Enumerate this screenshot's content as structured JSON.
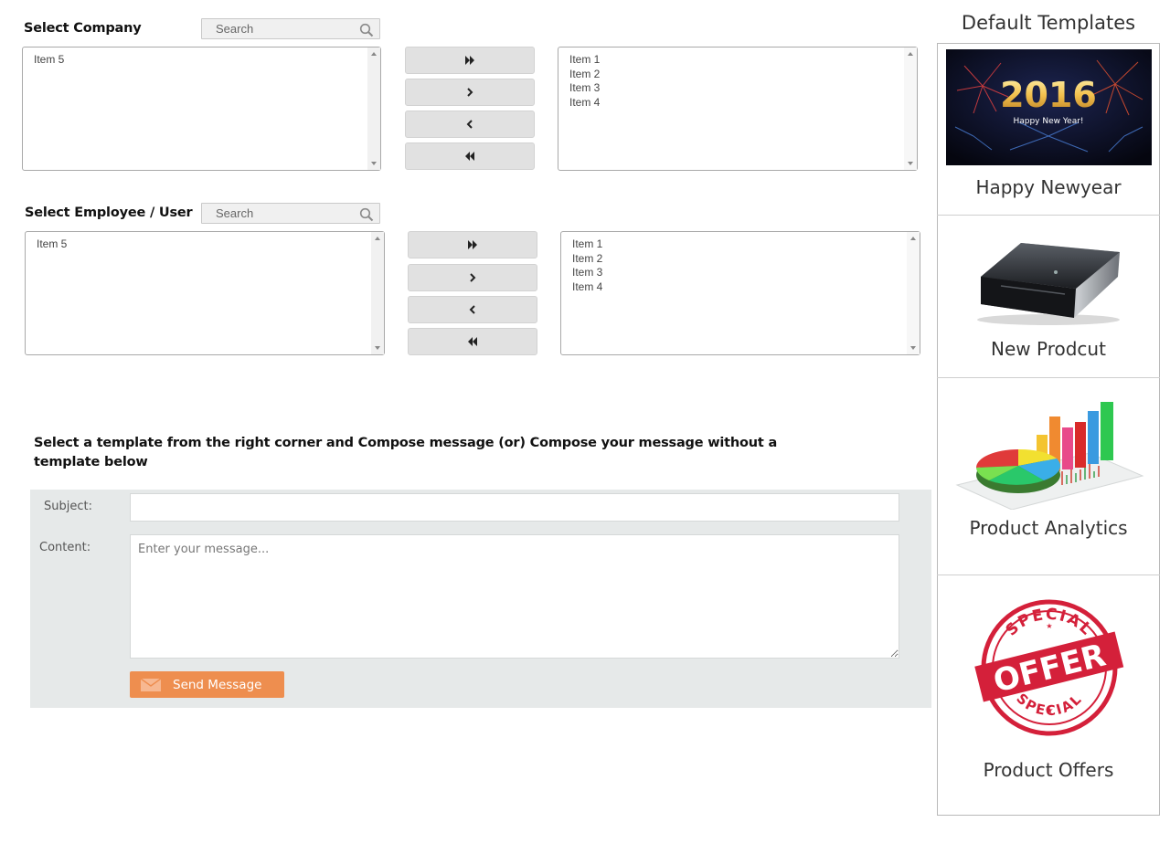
{
  "company": {
    "label": "Select Company",
    "search_placeholder": "Search",
    "available": [
      "Item 5"
    ],
    "selected": [
      "Item 1",
      "Item 2",
      "Item 3",
      "Item 4"
    ]
  },
  "employee": {
    "label": "Select Employee / User",
    "search_placeholder": "Search",
    "available": [
      "Item 5"
    ],
    "selected": [
      "Item 1",
      "Item 2",
      "Item 3",
      "Item 4"
    ]
  },
  "instructions": "Select a template from the right corner and Compose message (or) Compose your message without a template below",
  "compose": {
    "subject_label": "Subject:",
    "subject_value": "",
    "content_label": "Content:",
    "content_placeholder": "Enter your message...",
    "send_label": "Send Message",
    "send_color": "#ee8e4f"
  },
  "templates": {
    "title": "Default Templates",
    "items": [
      {
        "caption": "Happy Newyear",
        "image_text": "2016",
        "image_subtext": "Happy New Year!"
      },
      {
        "caption": "New Prodcut"
      },
      {
        "caption": "Product Analytics"
      },
      {
        "caption": "Product Offers",
        "image_text": "OFFER",
        "image_ring_top": "SPECIAL",
        "image_ring_bottom": "SPECIAL"
      }
    ]
  }
}
